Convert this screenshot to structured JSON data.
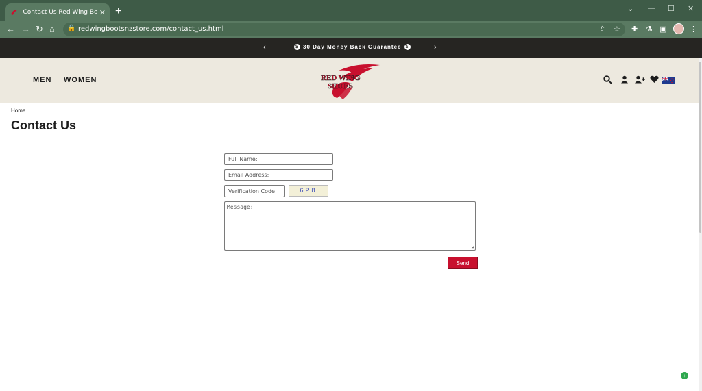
{
  "browser": {
    "tab_title": "Contact Us Red Wing Boots New",
    "tab_close": "✕",
    "new_tab": "+",
    "url": "redwingbootsnzstore.com/contact_us.html",
    "window_controls": {
      "minimize": "—",
      "maximize": "☐",
      "close": "✕",
      "menu": "⌄"
    },
    "nav_icons": {
      "back": "←",
      "forward": "→",
      "reload": "↻",
      "home": "⌂"
    },
    "toolbar_icons": {
      "share": "⇪",
      "star": "☆",
      "extensions": "✚",
      "labs": "⚗",
      "sidepanel": "▣",
      "more": "⋮"
    }
  },
  "promo": {
    "text": "30 Day Money Back Guarantee",
    "prev": "‹",
    "next": "›",
    "coin_glyph": "$"
  },
  "header": {
    "nav": {
      "men": "MEN",
      "women": "WOMEN"
    },
    "logo": {
      "line1": "RED WING",
      "line2": "SHOES"
    },
    "icons": {
      "search": "search-icon",
      "account": "user-icon",
      "register": "add-user-icon",
      "wishlist": "heart-icon",
      "region": "nz-flag-icon"
    }
  },
  "breadcrumb": "Home",
  "page_title": "Contact Us",
  "form": {
    "full_name_placeholder": "Full Name:",
    "email_placeholder": "Email Address:",
    "verification_placeholder": "Verification Code",
    "captcha_text": "6P8",
    "message_placeholder": "Message:",
    "send_label": "Send"
  },
  "colors": {
    "browser_chrome": "#3e5b47",
    "promo_bar": "#262522",
    "header_bg": "#ede9df",
    "accent_red": "#c8102e"
  }
}
